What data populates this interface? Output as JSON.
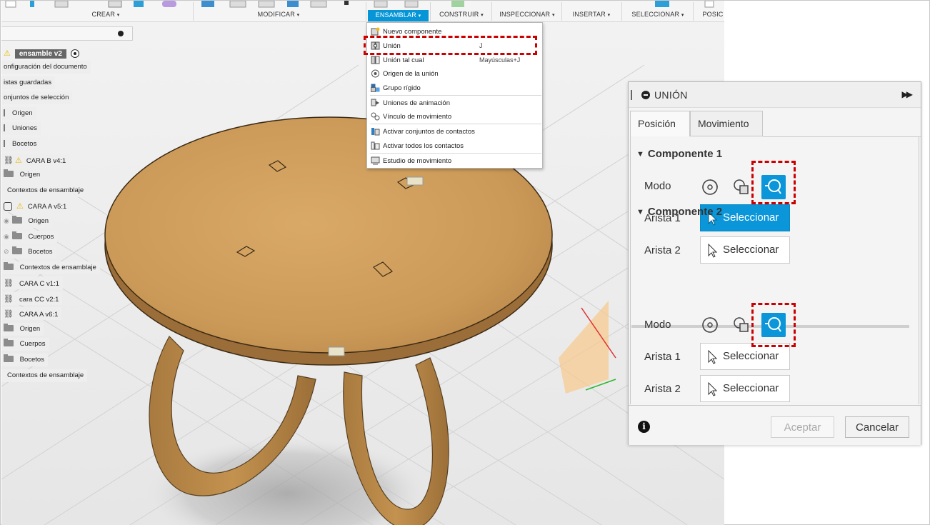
{
  "toolbar": {
    "menus": [
      {
        "label": "CREAR",
        "active": false
      },
      {
        "label": "MODIFICAR",
        "active": false
      },
      {
        "label": "ENSAMBLAR",
        "active": true
      },
      {
        "label": "CONSTRUIR",
        "active": false
      },
      {
        "label": "INSPECCIONAR",
        "active": false
      },
      {
        "label": "INSERTAR",
        "active": false
      },
      {
        "label": "SELECCIONAR",
        "active": false
      },
      {
        "label": "POSIC",
        "active": false
      }
    ],
    "caret": "▾",
    "accent": "#0696d7"
  },
  "browser": {
    "root": {
      "name": "ensamble v2",
      "warning": true
    },
    "items": [
      {
        "label": "onfiguración del documento",
        "icon": "none"
      },
      {
        "label": "istas guardadas",
        "icon": "none"
      },
      {
        "label": "onjuntos de selección",
        "icon": "none"
      },
      {
        "label": "Origen",
        "icon": "folder-tick"
      },
      {
        "label": "Uniones",
        "icon": "folder-tick"
      },
      {
        "label": "Bocetos",
        "icon": "folder-tick"
      },
      {
        "label": "CARA B v4:1",
        "icon": "warning-link"
      },
      {
        "label": "Origen",
        "icon": "folder"
      },
      {
        "label": "Contextos de ensamblaje",
        "icon": "none"
      },
      {
        "label": "CARA A v5:1",
        "icon": "warning-component"
      },
      {
        "label": "Origen",
        "icon": "eye-folder"
      },
      {
        "label": "Cuerpos",
        "icon": "eye-folder"
      },
      {
        "label": "Bocetos",
        "icon": "eye-hidden-folder"
      },
      {
        "label": "Contextos de ensamblaje",
        "icon": "folder"
      },
      {
        "label": "CARA C v1:1",
        "icon": "link"
      },
      {
        "label": "cara CC v2:1",
        "icon": "link"
      },
      {
        "label": "CARA A v6:1",
        "icon": "link"
      },
      {
        "label": "Origen",
        "icon": "folder"
      },
      {
        "label": "Cuerpos",
        "icon": "folder"
      },
      {
        "label": "Bocetos",
        "icon": "folder"
      },
      {
        "label": "Contextos de ensamblaje",
        "icon": "none"
      }
    ]
  },
  "dropdown": {
    "items": [
      {
        "label": "Nuevo componente",
        "shortcut": "",
        "icon": "new-component-icon"
      },
      {
        "label": "Unión",
        "shortcut": "J",
        "icon": "joint-icon"
      },
      {
        "label": "Unión tal cual",
        "shortcut": "Mayúsculas+J",
        "icon": "as-built-joint-icon"
      },
      {
        "label": "Origen de la unión",
        "shortcut": "",
        "icon": "joint-origin-icon"
      },
      {
        "label": "Grupo rígido",
        "shortcut": "",
        "icon": "rigid-group-icon"
      },
      {
        "label": "Uniones de animación",
        "shortcut": "",
        "icon": "drive-joints-icon"
      },
      {
        "label": "Vínculo de movimiento",
        "shortcut": "",
        "icon": "motion-link-icon"
      },
      {
        "label": "Activar conjuntos de contactos",
        "shortcut": "",
        "icon": "contact-sets-icon"
      },
      {
        "label": "Activar todos los contactos",
        "shortcut": "",
        "icon": "all-contacts-icon"
      },
      {
        "label": "Estudio de movimiento",
        "shortcut": "",
        "icon": "motion-study-icon"
      }
    ]
  },
  "dialog": {
    "title": "UNIÓN",
    "tabs": [
      "Posición",
      "Movimiento"
    ],
    "active_tab": "Posición",
    "component1": {
      "title": "Componente 1",
      "mode_label": "Modo",
      "edge1_label": "Arista 1",
      "edge1_button": "Seleccionar",
      "edge1_active": true,
      "edge2_label": "Arista 2",
      "edge2_button": "Seleccionar"
    },
    "component2": {
      "title": "Componente 2",
      "mode_label": "Modo",
      "edge1_label": "Arista 1",
      "edge1_button": "Seleccionar",
      "edge2_label": "Arista 2",
      "edge2_button": "Seleccionar"
    },
    "ok_label": "Aceptar",
    "cancel_label": "Cancelar",
    "accent": "#0a96d8"
  },
  "highlight_color": "#cc0000"
}
